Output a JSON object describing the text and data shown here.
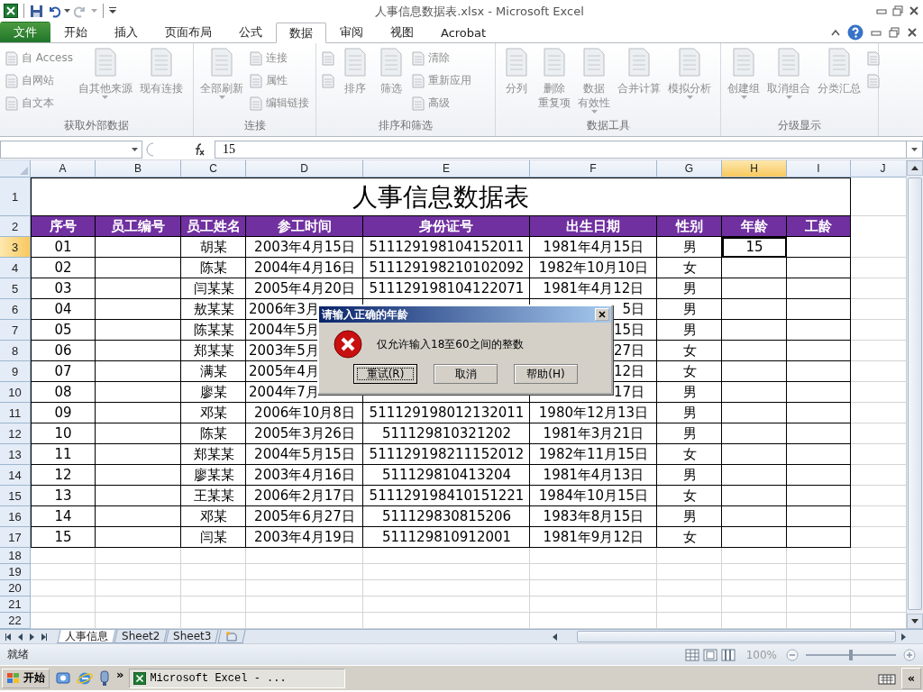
{
  "title_bar": {
    "title": "人事信息数据表.xlsx - Microsoft Excel"
  },
  "ribbon_tabs": [
    {
      "label": "文件",
      "kind": "file",
      "selected": false
    },
    {
      "label": "开始",
      "kind": "tab",
      "selected": false
    },
    {
      "label": "插入",
      "kind": "tab",
      "selected": false
    },
    {
      "label": "页面布局",
      "kind": "tab",
      "selected": false
    },
    {
      "label": "公式",
      "kind": "tab",
      "selected": false
    },
    {
      "label": "数据",
      "kind": "tab",
      "selected": true
    },
    {
      "label": "审阅",
      "kind": "tab",
      "selected": false
    },
    {
      "label": "视图",
      "kind": "tab",
      "selected": false
    },
    {
      "label": "Acrobat",
      "kind": "tab",
      "selected": false
    }
  ],
  "ribbon": {
    "disabled": true,
    "groups": [
      {
        "label": "获取外部数据",
        "items": [
          {
            "kind": "stack",
            "entries": [
              "自 Access",
              "自网站",
              "自文本"
            ]
          },
          {
            "kind": "large",
            "label": [
              "自其他来源"
            ],
            "dropdown": true
          },
          {
            "kind": "large",
            "label": [
              "现有连接"
            ],
            "dropdown": false
          }
        ]
      },
      {
        "label": "连接",
        "items": [
          {
            "kind": "large",
            "label": [
              "全部刷新"
            ],
            "dropdown": true
          },
          {
            "kind": "stack",
            "entries": [
              "连接",
              "属性",
              "编辑链接"
            ]
          }
        ]
      },
      {
        "label": "排序和筛选",
        "items": [
          {
            "kind": "icons"
          },
          {
            "kind": "large",
            "label": [
              "排序"
            ],
            "dropdown": false
          },
          {
            "kind": "large",
            "label": [
              "筛选"
            ],
            "dropdown": false
          },
          {
            "kind": "stack",
            "entries": [
              "清除",
              "重新应用",
              "高级"
            ]
          }
        ]
      },
      {
        "label": "数据工具",
        "items": [
          {
            "kind": "large",
            "label": [
              "分列"
            ],
            "dropdown": false
          },
          {
            "kind": "large",
            "label": [
              "删除",
              "重复项"
            ],
            "dropdown": false
          },
          {
            "kind": "large",
            "label": [
              "数据",
              "有效性"
            ],
            "dropdown": true
          },
          {
            "kind": "large",
            "label": [
              "合并计算"
            ],
            "dropdown": false
          },
          {
            "kind": "large",
            "label": [
              "模拟分析"
            ],
            "dropdown": true
          }
        ]
      },
      {
        "label": "分级显示",
        "items": [
          {
            "kind": "large",
            "label": [
              "创建组"
            ],
            "dropdown": true
          },
          {
            "kind": "large",
            "label": [
              "取消组合"
            ],
            "dropdown": true
          },
          {
            "kind": "large",
            "label": [
              "分类汇总"
            ],
            "dropdown": false
          },
          {
            "kind": "icons"
          }
        ]
      }
    ]
  },
  "formula_bar": {
    "value": "15"
  },
  "sheet": {
    "columns": [
      {
        "label": "A",
        "selected": false
      },
      {
        "label": "B",
        "selected": false
      },
      {
        "label": "C",
        "selected": false
      },
      {
        "label": "D",
        "selected": false
      },
      {
        "label": "E",
        "selected": false
      },
      {
        "label": "F",
        "selected": false
      },
      {
        "label": "G",
        "selected": false
      },
      {
        "label": "H",
        "selected": true
      },
      {
        "label": "I",
        "selected": false
      },
      {
        "label": "J",
        "selected": false
      }
    ],
    "title_row": "1",
    "title": "人事信息数据表",
    "header_row": "2",
    "headers": [
      "序号",
      "员工编号",
      "员工姓名",
      "参工时间",
      "身份证号",
      "出生日期",
      "性别",
      "年龄",
      "工龄"
    ],
    "rows": [
      {
        "row": "3",
        "selected": true,
        "covered": false,
        "no": "01",
        "name": "胡某",
        "start": "2003年4月15日",
        "id": "511129198104152011",
        "birth": "1981年4月15日",
        "sex": "男",
        "age": "15"
      },
      {
        "row": "4",
        "selected": false,
        "covered": false,
        "no": "02",
        "name": "陈某",
        "start": "2004年4月16日",
        "id": "511129198210102092",
        "birth": "1982年10月10日",
        "sex": "女"
      },
      {
        "row": "5",
        "selected": false,
        "covered": false,
        "no": "03",
        "name": "闫某某",
        "start": "2005年4月20日",
        "id": "511129198104122071",
        "birth": "1981年4月12日",
        "sex": "男"
      },
      {
        "row": "6",
        "selected": false,
        "covered": true,
        "no": "04",
        "name": "敖某某",
        "start": "2006年3月",
        "birth": "5日",
        "sex": "男"
      },
      {
        "row": "7",
        "selected": false,
        "covered": true,
        "no": "05",
        "name": "陈某某",
        "start": "2004年5月",
        "birth": "15日",
        "sex": "男"
      },
      {
        "row": "8",
        "selected": false,
        "covered": true,
        "no": "06",
        "name": "郑某某",
        "start": "2003年5月",
        "birth": "27日",
        "sex": "女"
      },
      {
        "row": "9",
        "selected": false,
        "covered": true,
        "no": "07",
        "name": "满某",
        "start": "2005年4月",
        "birth": "12日",
        "sex": "女"
      },
      {
        "row": "10",
        "selected": false,
        "covered": true,
        "no": "08",
        "name": "廖某",
        "start": "2004年7月",
        "birth": "17日",
        "sex": "男"
      },
      {
        "row": "11",
        "selected": false,
        "covered": false,
        "no": "09",
        "name": "邓某",
        "start": "2006年10月8日",
        "id": "511129198012132011",
        "birth": "1980年12月13日",
        "sex": "男"
      },
      {
        "row": "12",
        "selected": false,
        "covered": false,
        "no": "10",
        "name": "陈某",
        "start": "2005年3月26日",
        "id": "511129810321202",
        "birth": "1981年3月21日",
        "sex": "男"
      },
      {
        "row": "13",
        "selected": false,
        "covered": false,
        "no": "11",
        "name": "郑某某",
        "start": "2004年5月15日",
        "id": "511129198211152012",
        "birth": "1982年11月15日",
        "sex": "女"
      },
      {
        "row": "14",
        "selected": false,
        "covered": false,
        "no": "12",
        "name": "廖某某",
        "start": "2003年4月16日",
        "id": "511129810413204",
        "birth": "1981年4月13日",
        "sex": "男"
      },
      {
        "row": "15",
        "selected": false,
        "covered": false,
        "no": "13",
        "name": "王某某",
        "start": "2006年2月17日",
        "id": "511129198410151221",
        "birth": "1984年10月15日",
        "sex": "女"
      },
      {
        "row": "16",
        "selected": false,
        "covered": false,
        "no": "14",
        "name": "邓某",
        "start": "2005年6月27日",
        "id": "511129830815206",
        "birth": "1983年8月15日",
        "sex": "男"
      },
      {
        "row": "17",
        "selected": false,
        "covered": false,
        "no": "15",
        "name": "闫某",
        "start": "2003年4月19日",
        "id": "511129810912001",
        "birth": "1981年9月12日",
        "sex": "女"
      }
    ],
    "empty_rows": [
      "18",
      "19",
      "20",
      "21",
      "22"
    ]
  },
  "dialog": {
    "title": "请输入正确的年龄",
    "message": "仅允许输入18至60之间的整数",
    "buttons": [
      {
        "label": "重试(R)",
        "selected": true
      },
      {
        "label": "取消",
        "selected": false
      },
      {
        "label": "帮助(H)",
        "selected": false
      }
    ]
  },
  "sheet_tabs": [
    {
      "label": "人事信息",
      "selected": true
    },
    {
      "label": "Sheet2",
      "selected": false
    },
    {
      "label": "Sheet3",
      "selected": false
    }
  ],
  "status_bar": {
    "status": "就绪",
    "zoom": "100%",
    "zoom_slider": {
      "level": 0.5
    }
  },
  "taskbar": {
    "start": "开始",
    "more": "»",
    "tasks": [
      {
        "label": "Microsoft Excel - ..."
      }
    ],
    "tray_toggle": "«"
  }
}
